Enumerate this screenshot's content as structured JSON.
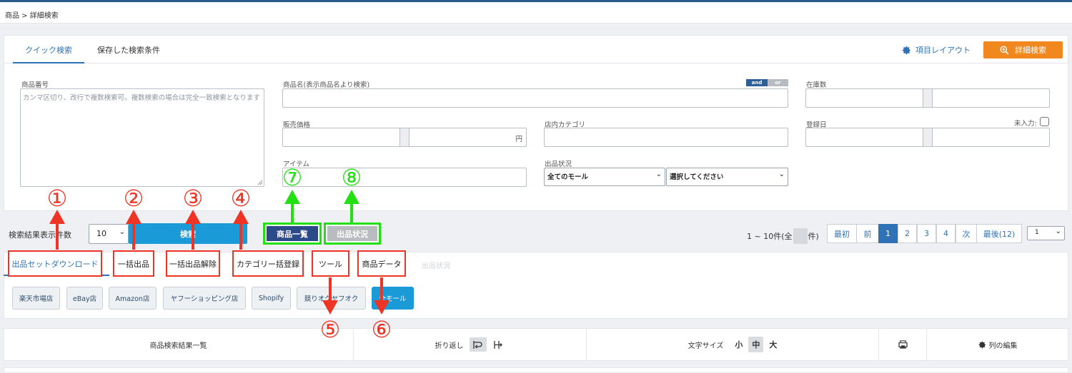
{
  "breadcrumb": "商品 > 詳細検索",
  "tabs": {
    "quick": "クイック検索",
    "saved": "保存した検索条件"
  },
  "layout_label": "項目レイアウト",
  "detail_search_label": "詳細検索",
  "and_label": "and",
  "or_label": "or",
  "fields": {
    "product_no": {
      "label": "商品番号",
      "placeholder": "カンマ区切り、改行で複数検索可。複数検索の場合は完全一致検索となります"
    },
    "product_name": "商品名(表示商品名より検索)",
    "stock": "在庫数",
    "price": "販売価格",
    "price_unit": "円",
    "category": "店内カテゴリ",
    "reg_date": "登録日",
    "unentered": "未入力:",
    "item": "アイテム",
    "status": "出品状況",
    "mall_select": "全てのモール",
    "choose_select": "選択してください"
  },
  "results_count_label": "検索結果表示件数",
  "per_page_value": "10",
  "search_button": "検索",
  "product_list_button": "商品一覧",
  "listing_status_button": "出品状況",
  "range_text": "1 ~ 10件(全",
  "range_suffix": "件)",
  "pagination": [
    "最初",
    "前",
    "1",
    "2",
    "3",
    "4",
    "次",
    "最後(12)"
  ],
  "page_select": "1",
  "menu_tabs": [
    "出品セットダウンロード",
    "一括出品",
    "一括出品解除",
    "カテゴリー括登録",
    "ツール",
    "商品データ",
    "出品状況"
  ],
  "malls": [
    "楽天市場店",
    "eBay店",
    "Amazon店",
    "ヤフーショッピング店",
    "Shopify",
    "競りオクヤフオク",
    "全モール"
  ],
  "toolbar": {
    "list_title": "商品検索結果一覧",
    "wrap_label": "折り返し",
    "font_size_label": "文字サイズ",
    "small": "小",
    "medium": "中",
    "large": "大",
    "edit_columns": "列の編集"
  },
  "annotations": [
    "①",
    "②",
    "③",
    "④",
    "⑤",
    "⑥",
    "⑦",
    "⑧"
  ],
  "colors": {
    "accent": "#2f73b6",
    "orange": "#f0871f",
    "annotation_red": "#ee3424",
    "annotation_green": "#22e011",
    "search_blue": "#1a9ad6",
    "dark_blue": "#2c4a8a"
  }
}
